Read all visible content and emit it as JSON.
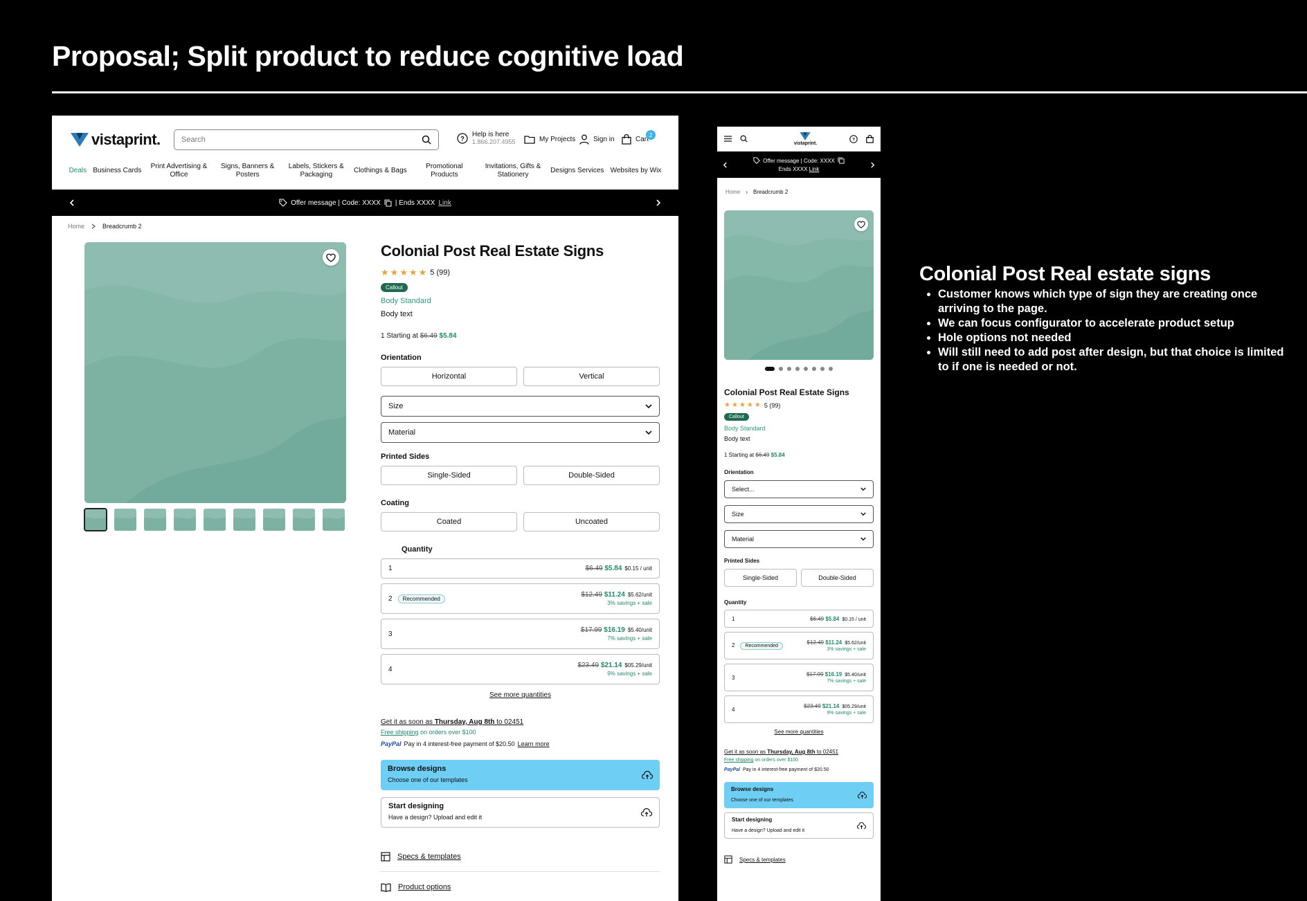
{
  "slide": {
    "title": "Proposal; Split product to reduce cognitive load"
  },
  "header": {
    "logo": "vistaprint.",
    "search_placeholder": "Search",
    "help_title": "Help is here",
    "help_phone": "1.866.207.4955",
    "my_projects": "My Projects",
    "sign_in": "Sign in",
    "cart": "Cart",
    "cart_count": "2"
  },
  "nav": [
    "Deals",
    "Business Cards",
    "Print Advertising & Office",
    "Signs, Banners & Posters",
    "Labels, Stickers & Packaging",
    "Clothings & Bags",
    "Promotional Products",
    "Invitations, Gifts & Stationery",
    "Designs Services",
    "Websites by Wix"
  ],
  "offer": {
    "message": "Offer message | Code: XXXX",
    "ends": "| Ends XXXX",
    "link": "Link"
  },
  "breadcrumb": {
    "home": "Home",
    "current": "Breadcrumb 2"
  },
  "product": {
    "title": "Colonial Post Real Estate Signs",
    "rating_text": "5 (99)",
    "rating": 5,
    "callout": "Callout",
    "body_standard": "Body Standard",
    "body_text": "Body text",
    "starting_prefix": "1 Starting at",
    "old_price": "$6.49",
    "new_price": "$5.84",
    "orientation_label": "Orientation",
    "orientation_options": [
      "Horizontal",
      "Vertical"
    ],
    "orientation_select": "Select...",
    "size_label": "Size",
    "material_label": "Material",
    "printed_sides_label": "Printed Sides",
    "printed_sides_options": [
      "Single-Sided",
      "Double-Sided"
    ],
    "coating_label": "Coating",
    "coating_options": [
      "Coated",
      "Uncoated"
    ],
    "quantity_label": "Quantity",
    "quantities": [
      {
        "qty": "1",
        "old": "$6.49",
        "new": "$5.84",
        "unit": "$0.15 / unit",
        "savings": ""
      },
      {
        "qty": "2",
        "old": "$12.49",
        "new": "$11.24",
        "unit": "$5.62/unit",
        "savings": "3% savings + sale",
        "badge": "Recommended"
      },
      {
        "qty": "3",
        "old": "$17.99",
        "new": "$16.19",
        "unit": "$5.40/unit",
        "savings": "7% savings + sale"
      },
      {
        "qty": "4",
        "old": "$23.49",
        "new": "$21.14",
        "unit": "$05.29/unit",
        "savings": "9% savings + sale"
      }
    ],
    "see_more": "See more quantities",
    "delivery_prefix": "Get it as soon as",
    "delivery_date": "Thursday, Aug 8th",
    "delivery_to": "to 02451",
    "free_shipping": "Free shipping",
    "free_shipping_suffix": "on orders over $100",
    "paypal_logo": "PayPal",
    "paypal_text": "Pay in 4 interest-free payment of $20.50",
    "learn_more": "Learn more",
    "browse_title": "Browse designs",
    "browse_sub": "Choose one of our templates",
    "start_title": "Start designing",
    "start_sub": "Have a design? Upload and edit it",
    "specs": "Specs & templates",
    "options": "Product options"
  },
  "mobile": {
    "offer_line1": "Offer message | Code: XXXX",
    "offer_line2": "Ends XXXX",
    "logo": "vistaprint."
  },
  "notes": {
    "title": "Colonial Post Real estate signs",
    "bullets": [
      "Customer knows which type of sign they are creating once arriving to the page.",
      "We can focus configurator to accelerate product setup",
      "Hole options not needed",
      "Will still need to add post after design, but that choice is limited to if one is needed or not."
    ]
  },
  "colors": {
    "accent_green": "#1f8a6a",
    "browse_blue": "#6fcef3",
    "image_teal": "#7fb5a6",
    "star": "#e8a33d"
  }
}
